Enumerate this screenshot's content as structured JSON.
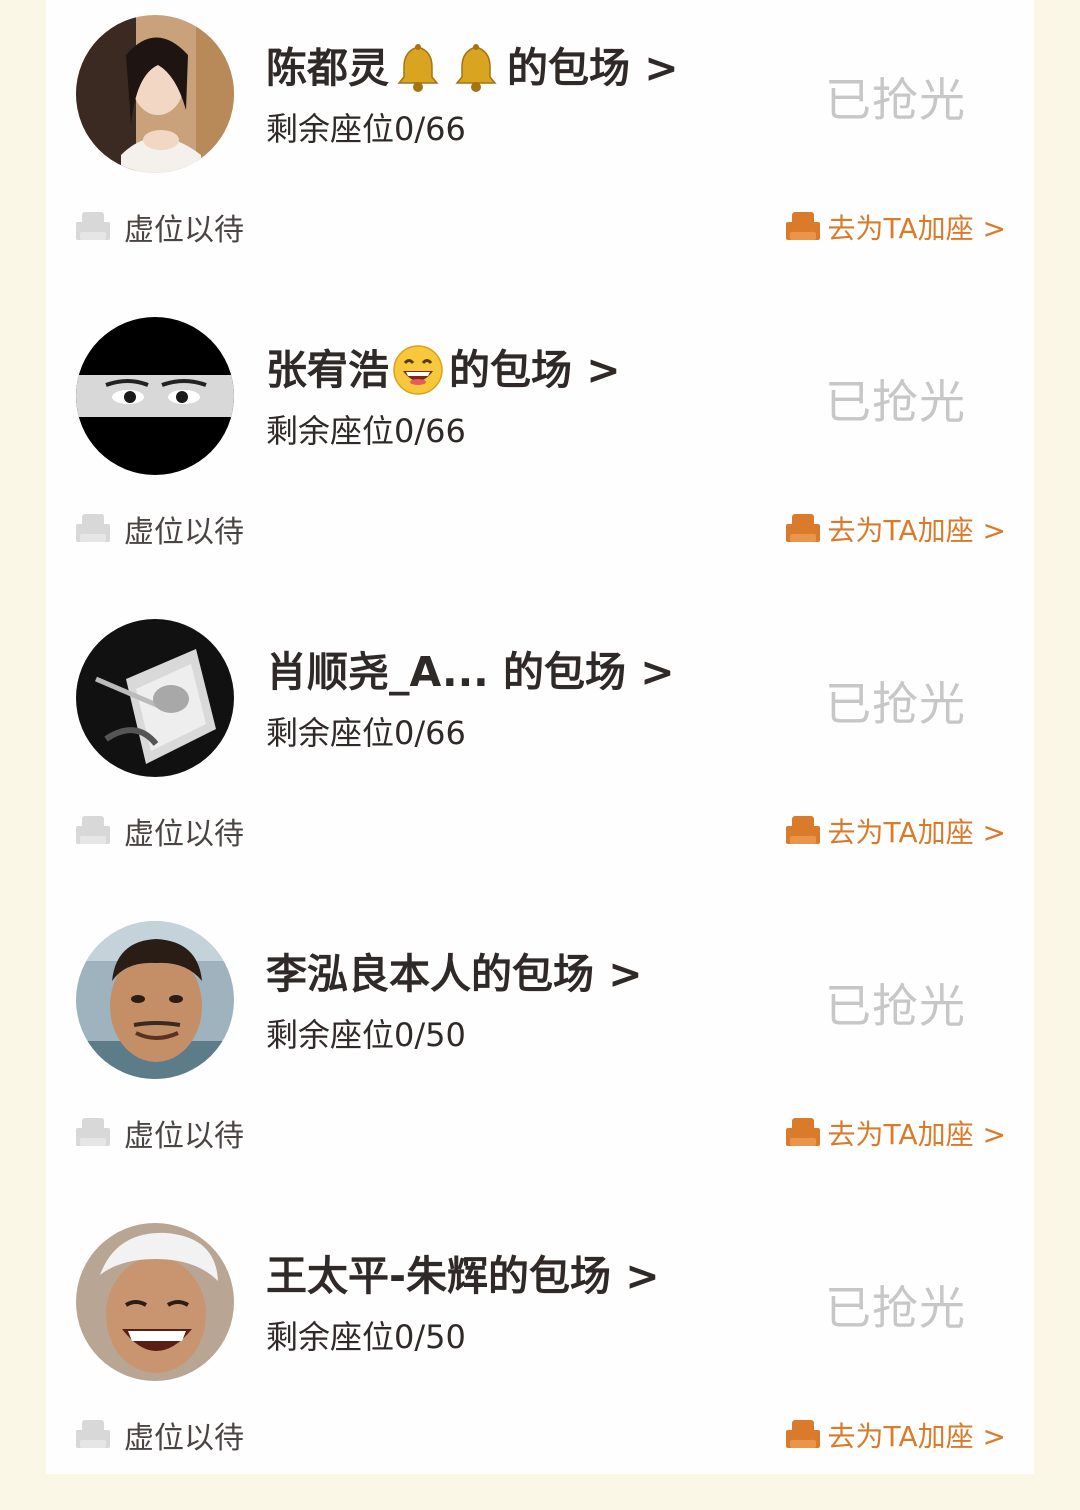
{
  "colors": {
    "page_background": "#fbf7e6",
    "panel_background": "#fefefe",
    "title_text": "#2f2a28",
    "soldout_text": "#c7c7c7",
    "accent_orange": "#d97b2a",
    "seat_icon_gray": "#d8d8d8"
  },
  "cards": [
    {
      "name_prefix": "陈都灵",
      "emoji": [
        "bell-icon",
        "bell-icon"
      ],
      "name_suffix": "的包场 >",
      "seats": "剩余座位0/66",
      "status": "已抢光",
      "wait_label": "虚位以待",
      "add_seat_label": "去为TA加座 >"
    },
    {
      "name_prefix": "张宥浩",
      "emoji": [
        "grinning-face-icon"
      ],
      "name_suffix": "的包场 >",
      "seats": "剩余座位0/66",
      "status": "已抢光",
      "wait_label": "虚位以待",
      "add_seat_label": "去为TA加座 >"
    },
    {
      "name_prefix": "肖顺尧_A... 的包场 >",
      "emoji": [],
      "name_suffix": "",
      "seats": "剩余座位0/66",
      "status": "已抢光",
      "wait_label": "虚位以待",
      "add_seat_label": "去为TA加座 >"
    },
    {
      "name_prefix": "李泓良本人的包场 >",
      "emoji": [],
      "name_suffix": "",
      "seats": "剩余座位0/50",
      "status": "已抢光",
      "wait_label": "虚位以待",
      "add_seat_label": "去为TA加座 >"
    },
    {
      "name_prefix": "王太平-朱辉的包场 >",
      "emoji": [],
      "name_suffix": "",
      "seats": "剩余座位0/50",
      "status": "已抢光",
      "wait_label": "虚位以待",
      "add_seat_label": "去为TA加座 >"
    }
  ]
}
